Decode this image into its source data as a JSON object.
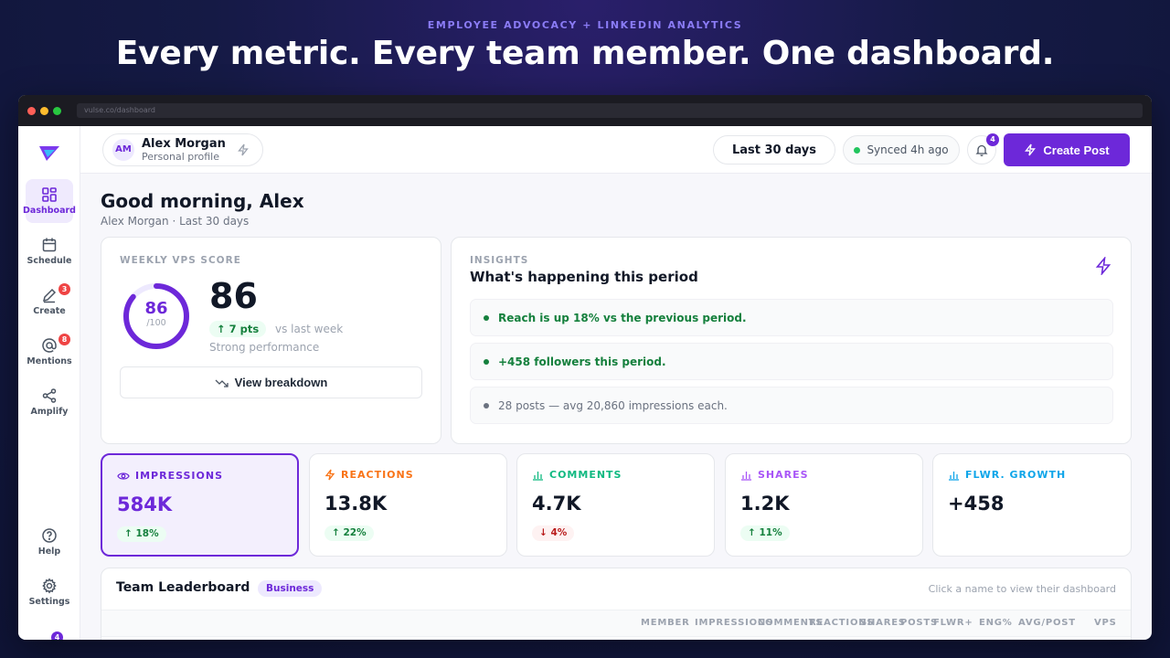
{
  "hero": {
    "eyebrow": "EMPLOYEE ADVOCACY + LINKEDIN ANALYTICS",
    "title": "Every metric. Every team member. One dashboard."
  },
  "browser": {
    "url": "vulse.co/dashboard"
  },
  "sidebar": {
    "items": [
      {
        "label": "Dashboard",
        "icon": "dashboard-icon",
        "badge": ""
      },
      {
        "label": "Schedule",
        "icon": "calendar-icon",
        "badge": ""
      },
      {
        "label": "Create",
        "icon": "pen-icon",
        "badge": "3"
      },
      {
        "label": "Mentions",
        "icon": "at-icon",
        "badge": "8"
      },
      {
        "label": "Amplify",
        "icon": "share-icon",
        "badge": ""
      }
    ],
    "bottom": [
      {
        "label": "Help",
        "icon": "help-icon"
      },
      {
        "label": "Settings",
        "icon": "gear-icon"
      }
    ],
    "extra_badge": "4"
  },
  "topbar": {
    "avatar_initials": "AM",
    "profile_name": "Alex Morgan",
    "profile_sub": "Personal profile",
    "period": "Last 30 days",
    "sync": "Synced 4h ago",
    "notifications": "4",
    "create_label": "Create Post"
  },
  "page": {
    "greeting": "Good morning, Alex",
    "subtitle": "Alex Morgan · Last 30 days"
  },
  "vps": {
    "eyebrow": "WEEKLY VPS SCORE",
    "score": "86",
    "denominator": "/100",
    "score_fraction": 0.86,
    "delta": "↑ 7 pts",
    "vs": "vs last week",
    "status": "Strong performance",
    "breakdown_label": "View breakdown"
  },
  "insights": {
    "eyebrow": "INSIGHTS",
    "title": "What's happening this period",
    "items": [
      {
        "text": "Reach is up 18% vs the previous period.",
        "tone": "#15803d"
      },
      {
        "text": "+458 followers this period.",
        "tone": "#15803d"
      },
      {
        "text": "28 posts — avg 20,860 impressions each.",
        "tone": "#6b7280"
      }
    ]
  },
  "metrics": [
    {
      "label": "IMPRESSIONS",
      "value": "584K",
      "delta": "↑ 18%",
      "dir": "up",
      "color": "#6d28d9",
      "icon": "eye-icon"
    },
    {
      "label": "REACTIONS",
      "value": "13.8K",
      "delta": "↑ 22%",
      "dir": "up",
      "color": "#f97316",
      "icon": "bolt-icon"
    },
    {
      "label": "COMMENTS",
      "value": "4.7K",
      "delta": "↓ 4%",
      "dir": "down",
      "color": "#10b981",
      "icon": "bar-chart-icon"
    },
    {
      "label": "SHARES",
      "value": "1.2K",
      "delta": "↑ 11%",
      "dir": "up",
      "color": "#a855f7",
      "icon": "bar-chart-icon"
    },
    {
      "label": "FLWR. GROWTH",
      "value": "+458",
      "delta": "",
      "dir": "",
      "color": "#0ea5e9",
      "icon": "bar-chart-icon"
    }
  ],
  "leaderboard": {
    "title": "Team Leaderboard",
    "tag": "Business",
    "hint": "Click a name to view their dashboard",
    "columns": [
      "MEMBER",
      "IMPRESSIONS",
      "COMMENTS",
      "REACTIONS",
      "SHARES",
      "POSTS",
      "FLWR+",
      "ENG%",
      "AVG/POST",
      "VPS"
    ]
  },
  "colors": {
    "accent": "#6d28d9"
  }
}
